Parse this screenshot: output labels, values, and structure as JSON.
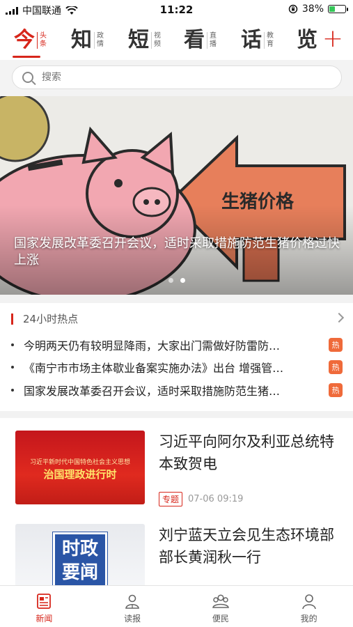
{
  "status": {
    "carrier": "中国联通",
    "time": "11:22",
    "battery": "38%",
    "battery_level": 0.38
  },
  "channels": [
    {
      "big": "今",
      "small1": "头",
      "small2": "条",
      "active": true
    },
    {
      "big": "知",
      "small1": "政",
      "small2": "情"
    },
    {
      "big": "短",
      "small1": "视",
      "small2": "频"
    },
    {
      "big": "看",
      "small1": "直",
      "small2": "播"
    },
    {
      "big": "话",
      "small1": "教",
      "small2": "育"
    },
    {
      "big": "览",
      "small1": "",
      "small2": ""
    }
  ],
  "add_channel_icon": "plus-icon",
  "search": {
    "placeholder": "搜索"
  },
  "banner": {
    "caption": "国家发展改革委召开会议，适时采取措施防范生猪价格过快上涨",
    "sign_text": "生猪价格",
    "page_index": 1,
    "page_count": 2
  },
  "hot": {
    "title": "24小时热点",
    "items": [
      {
        "text": "今明两天仍有较明显降雨，大家出门需做好防雷防…",
        "tag": "热"
      },
      {
        "text": "《南宁市市场主体歇业备案实施办法》出台 增强管…",
        "tag": "热"
      },
      {
        "text": "国家发展改革委召开会议，适时采取措施防范生猪…",
        "tag": "热"
      }
    ]
  },
  "news": [
    {
      "title": "习近平向阿尔及利亚总统特本致贺电",
      "label": "专题",
      "date": "07-06 09:19",
      "thumb_line1": "习近平新时代中国特色社会主义思想",
      "thumb_line2": "治国理政进行时"
    },
    {
      "title": "刘宁蓝天立会见生态环境部部长黄润秋一行",
      "thumb_line1": "时政",
      "thumb_line2": "要闻"
    }
  ],
  "tabbar": [
    {
      "label": "新闻",
      "icon": "news-icon",
      "active": true
    },
    {
      "label": "读报",
      "icon": "reader-icon"
    },
    {
      "label": "便民",
      "icon": "community-icon"
    },
    {
      "label": "我的",
      "icon": "profile-icon"
    }
  ],
  "colors": {
    "accent": "#d7261b",
    "hot_tag": "#ef6a3a"
  }
}
